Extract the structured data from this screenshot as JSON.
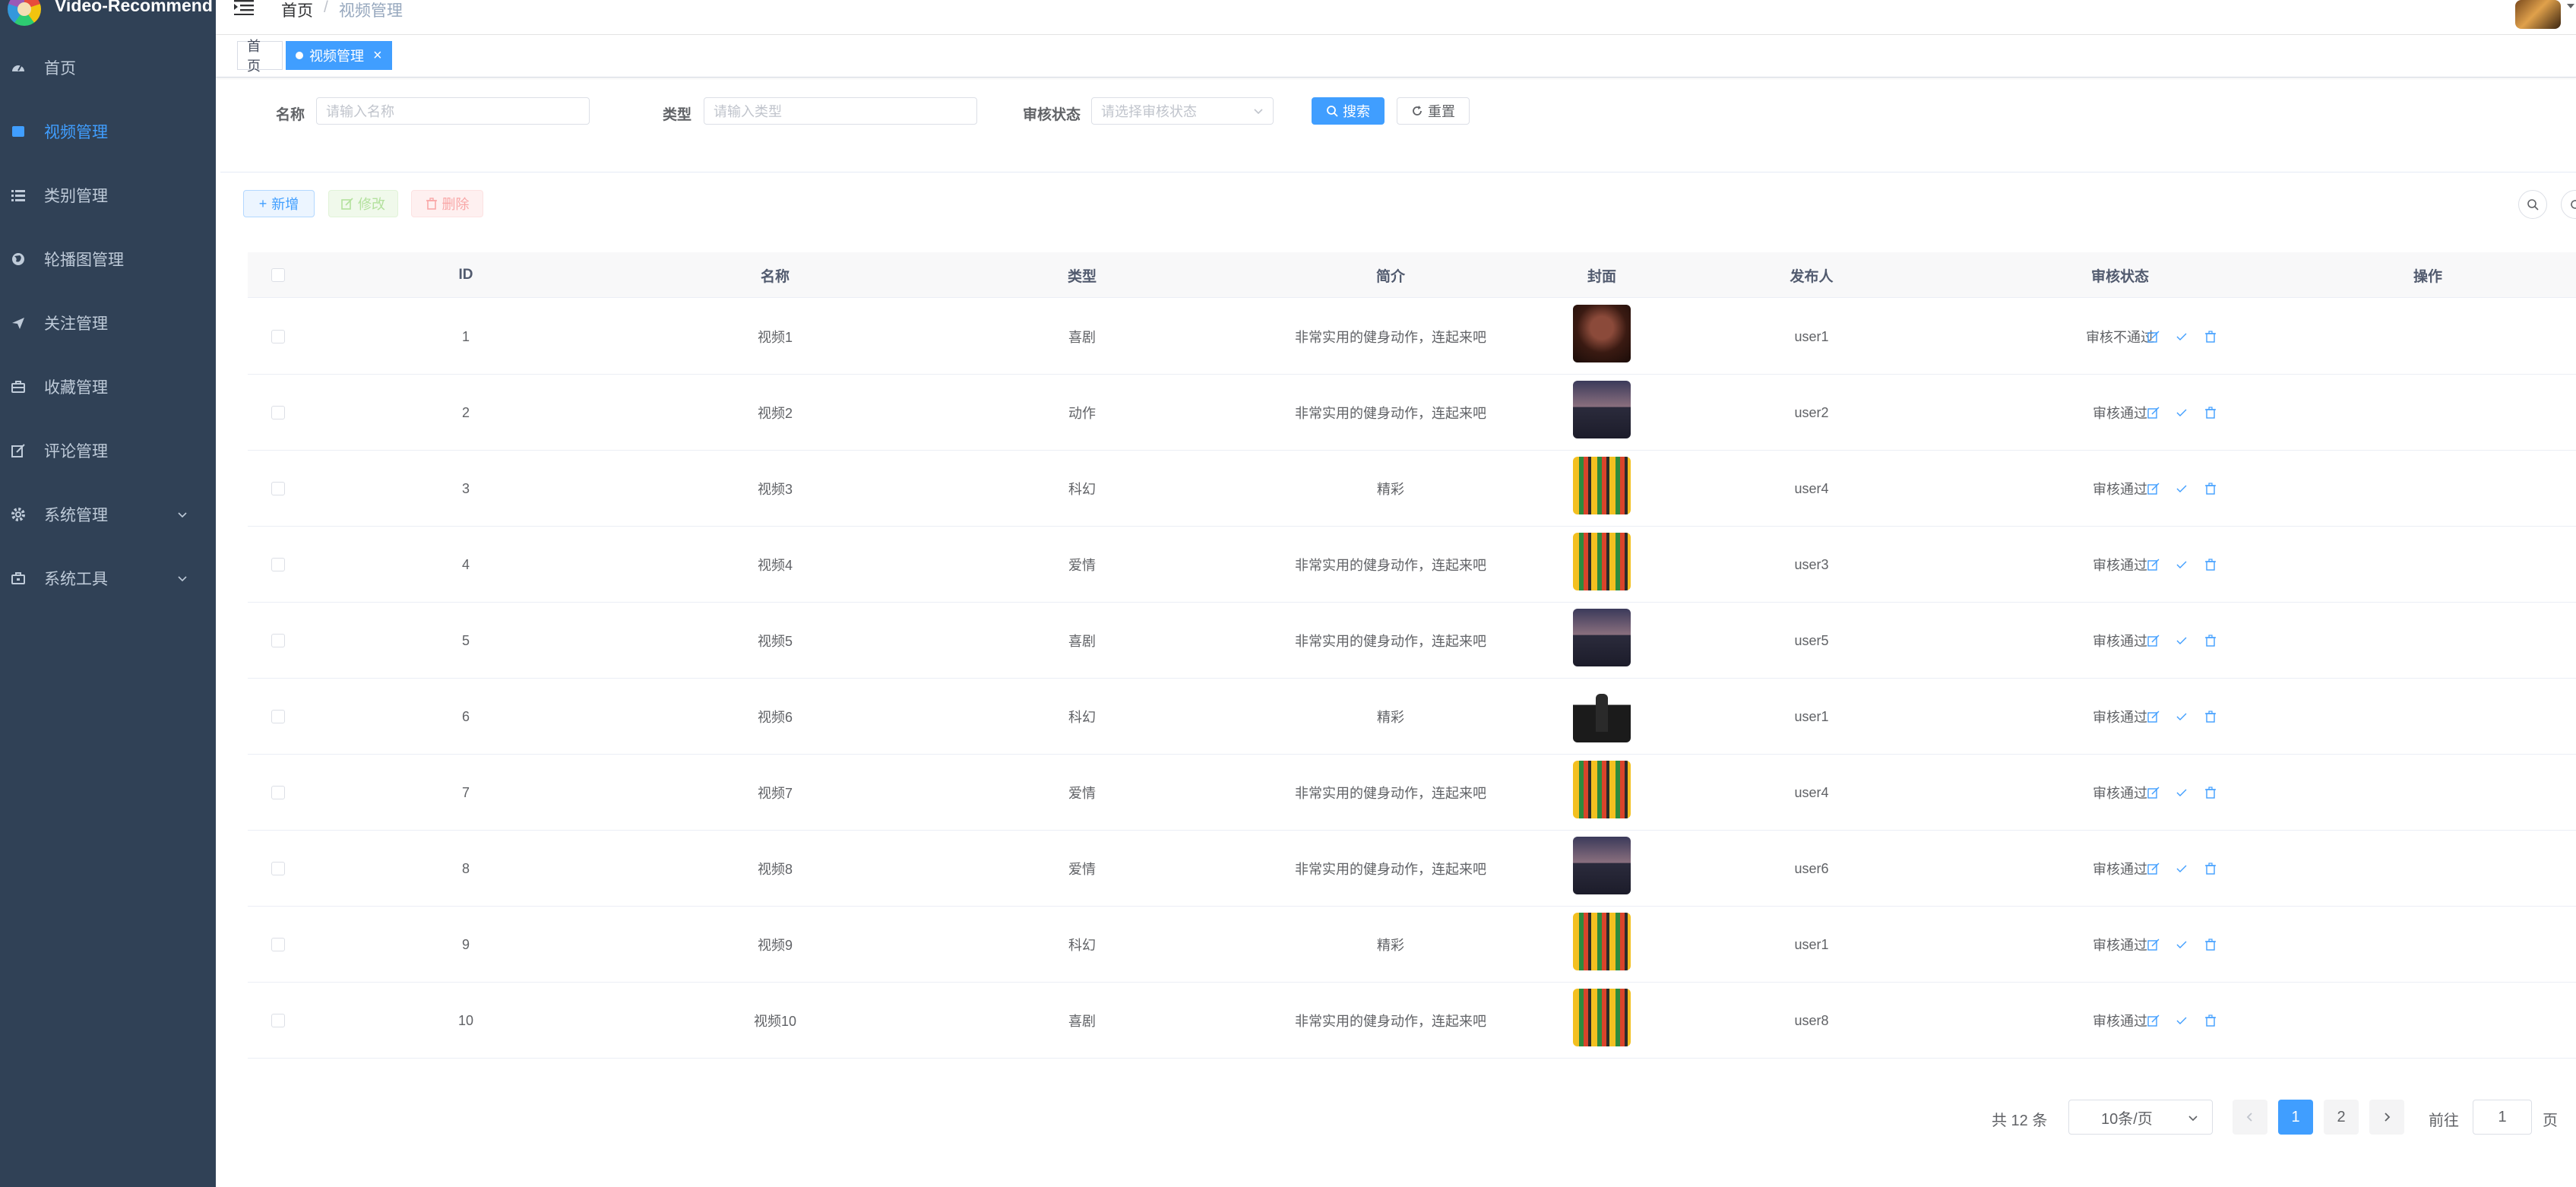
{
  "sidebar": {
    "logo_text": "Video-Recommend",
    "items": [
      {
        "label": "首页",
        "icon": "dashboard-icon"
      },
      {
        "label": "视频管理",
        "icon": "video-icon",
        "active": true
      },
      {
        "label": "类别管理",
        "icon": "list-icon"
      },
      {
        "label": "轮播图管理",
        "icon": "globe-icon"
      },
      {
        "label": "关注管理",
        "icon": "send-icon"
      },
      {
        "label": "收藏管理",
        "icon": "briefcase-icon"
      },
      {
        "label": "评论管理",
        "icon": "edit-icon"
      },
      {
        "label": "系统管理",
        "icon": "gear-icon",
        "expandable": true
      },
      {
        "label": "系统工具",
        "icon": "toolbox-icon",
        "expandable": true
      }
    ]
  },
  "header": {
    "breadcrumb_home": "首页",
    "breadcrumb_sep": "/",
    "breadcrumb_current": "视频管理"
  },
  "tags": [
    {
      "label": "首页",
      "active": false
    },
    {
      "label": "视频管理",
      "active": true
    }
  ],
  "search": {
    "name_label": "名称",
    "name_placeholder": "请输入名称",
    "type_label": "类型",
    "type_placeholder": "请输入类型",
    "status_label": "审核状态",
    "status_placeholder": "请选择审核状态",
    "search_btn": "搜索",
    "reset_btn": "重置"
  },
  "toolbar": {
    "add": "新增",
    "edit": "修改",
    "delete": "删除"
  },
  "table": {
    "columns": [
      "ID",
      "名称",
      "类型",
      "简介",
      "封面",
      "发布人",
      "审核状态",
      "操作"
    ],
    "rows": [
      {
        "id": "1",
        "name": "视频1",
        "type": "喜剧",
        "intro": "非常实用的健身动作，连起来吧",
        "cover": "portrait",
        "publisher": "user1",
        "status": "审核不通过"
      },
      {
        "id": "2",
        "name": "视频2",
        "type": "动作",
        "intro": "非常实用的健身动作，连起来吧",
        "cover": "mountain",
        "publisher": "user2",
        "status": "审核通过"
      },
      {
        "id": "3",
        "name": "视频3",
        "type": "科幻",
        "intro": "精彩",
        "cover": "city",
        "publisher": "user4",
        "status": "审核通过"
      },
      {
        "id": "4",
        "name": "视频4",
        "type": "爱情",
        "intro": "非常实用的健身动作，连起来吧",
        "cover": "city",
        "publisher": "user3",
        "status": "审核通过"
      },
      {
        "id": "5",
        "name": "视频5",
        "type": "喜剧",
        "intro": "非常实用的健身动作，连起来吧",
        "cover": "mountain",
        "publisher": "user5",
        "status": "审核通过"
      },
      {
        "id": "6",
        "name": "视频6",
        "type": "科幻",
        "intro": "精彩",
        "cover": "suit",
        "publisher": "user1",
        "status": "审核通过"
      },
      {
        "id": "7",
        "name": "视频7",
        "type": "爱情",
        "intro": "非常实用的健身动作，连起来吧",
        "cover": "city",
        "publisher": "user4",
        "status": "审核通过"
      },
      {
        "id": "8",
        "name": "视频8",
        "type": "爱情",
        "intro": "非常实用的健身动作，连起来吧",
        "cover": "mountain",
        "publisher": "user6",
        "status": "审核通过"
      },
      {
        "id": "9",
        "name": "视频9",
        "type": "科幻",
        "intro": "精彩",
        "cover": "city",
        "publisher": "user1",
        "status": "审核通过"
      },
      {
        "id": "10",
        "name": "视频10",
        "type": "喜剧",
        "intro": "非常实用的健身动作，连起来吧",
        "cover": "city",
        "publisher": "user8",
        "status": "审核通过"
      }
    ]
  },
  "pagination": {
    "total": "共 12 条",
    "page_size": "10条/页",
    "pages": [
      "1",
      "2"
    ],
    "current": "1",
    "goto_label": "前往",
    "goto_value": "1",
    "page_suffix": "页"
  },
  "colors": {
    "sidebar_bg": "#304156",
    "primary": "#409eff",
    "menu_text": "#bfcbd9"
  }
}
